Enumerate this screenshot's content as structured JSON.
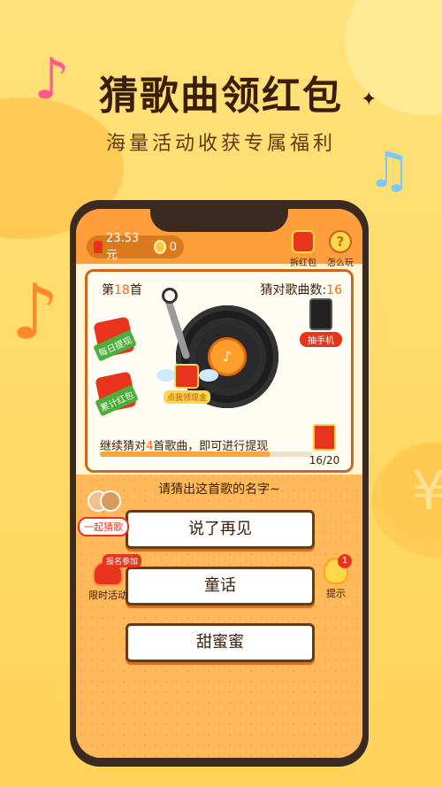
{
  "promo": {
    "headline": "猜歌曲领红包",
    "subline": "海量活动收获专属福利"
  },
  "topbar": {
    "balance": "23.53元",
    "coins": "0",
    "red_packet_label": "拆红包",
    "howto_label": "怎么玩",
    "howto_glyph": "?"
  },
  "game": {
    "song_prefix": "第",
    "song_number": "18",
    "song_suffix": "首",
    "correct_prefix": "猜对歌曲数:",
    "correct_count": "16",
    "daily_withdraw": "每日提现",
    "cumulative_red_packet": "累计红包",
    "prize_label": "抽手机",
    "progress_prefix": "继续猜对",
    "progress_count": "4",
    "progress_suffix": "首歌曲，即可进行提现",
    "progress_fraction": 0.8,
    "progress_counter": "16/20",
    "flying_packet_tag": "点我领现金"
  },
  "question": {
    "prompt": "请猜出这首歌的名字~",
    "answers": [
      "说了再见",
      "童话",
      "甜蜜蜜"
    ]
  },
  "side": {
    "together_label": "一起猜歌",
    "limited_badge": "报名参加",
    "limited_label": "限时活动",
    "hint_label": "提示",
    "hint_count": "1"
  },
  "colors": {
    "background": "#ffd95e",
    "header_orange": "#ff9e3a",
    "accent_red": "#e8341c",
    "text_dark": "#3b1e08"
  },
  "icons": [
    "music-note-icon",
    "star-icon",
    "red-packet-icon",
    "question-icon",
    "coin-icon",
    "vinyl-record-icon",
    "phone-icon",
    "lightbulb-icon"
  ]
}
